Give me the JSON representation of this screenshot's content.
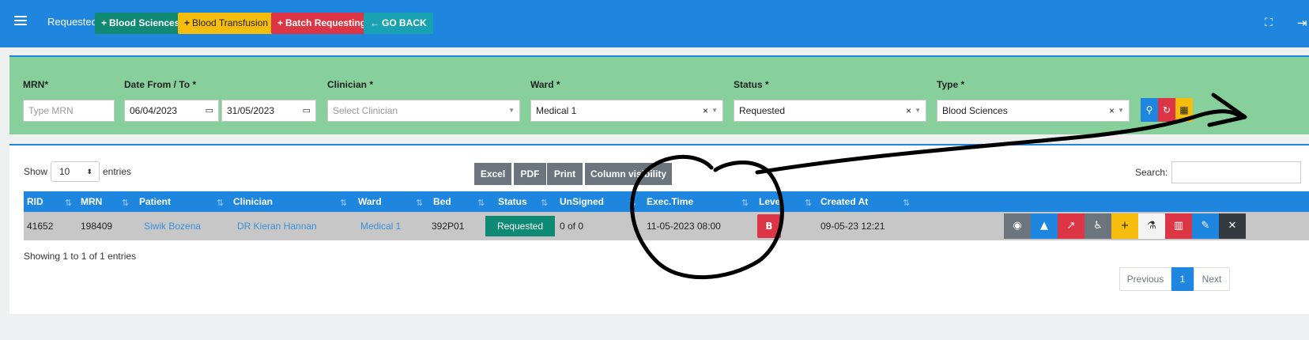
{
  "topbar": {
    "title": "Requested",
    "buttons": [
      {
        "label": "Blood Sciences",
        "icon": "+",
        "color": "#118a73"
      },
      {
        "label": "Blood Transfusion",
        "icon": "+",
        "color": "#f7bd0d"
      },
      {
        "label": "Batch Requesting",
        "icon": "+",
        "color": "#dc3545"
      },
      {
        "label": "GO BACK",
        "icon": "←",
        "color": "#19a2b1"
      }
    ]
  },
  "filters": {
    "mrn": {
      "label": "MRN*",
      "placeholder": "Type MRN"
    },
    "date": {
      "label": "Date From / To *",
      "from": "06/04/2023",
      "to": "31/05/2023"
    },
    "clinician": {
      "label": "Clinician *",
      "placeholder": "Select Clinician"
    },
    "ward": {
      "label": "Ward *",
      "value": "Medical 1"
    },
    "status": {
      "label": "Status *",
      "value": "Requested"
    },
    "type": {
      "label": "Type *",
      "value": "Blood Sciences"
    }
  },
  "table_controls": {
    "show_label": "Show",
    "entries_value": "10",
    "entries_label": "entries",
    "export_buttons": [
      "Excel",
      "PDF",
      "Print",
      "Column visibility"
    ],
    "search_label": "Search:"
  },
  "table": {
    "columns": [
      "RID",
      "MRN",
      "Patient",
      "Clinician",
      "Ward",
      "Bed",
      "Status",
      "UnSigned",
      "Exec.Time",
      "Level",
      "Created At"
    ],
    "rows": [
      {
        "rid": "41652",
        "mrn": "198409",
        "patient": "Siwik Bozena",
        "clinician": "DR Kieran Hannan",
        "ward": "Medical 1",
        "bed": "392P01",
        "status": "Requested",
        "unsigned": "0 of 0",
        "exec_time": "11-05-2023 08:00",
        "level": "B",
        "created_at": "09-05-23 12:21"
      }
    ]
  },
  "footer": {
    "info": "Showing 1 to 1 of 1 entries",
    "previous": "Previous",
    "page": "1",
    "next": "Next"
  },
  "colors": {
    "primary": "#1f86e0",
    "filter_bg": "#88d09b",
    "danger": "#dc3545",
    "warning": "#f7bd0d",
    "success": "#0e8a74"
  }
}
